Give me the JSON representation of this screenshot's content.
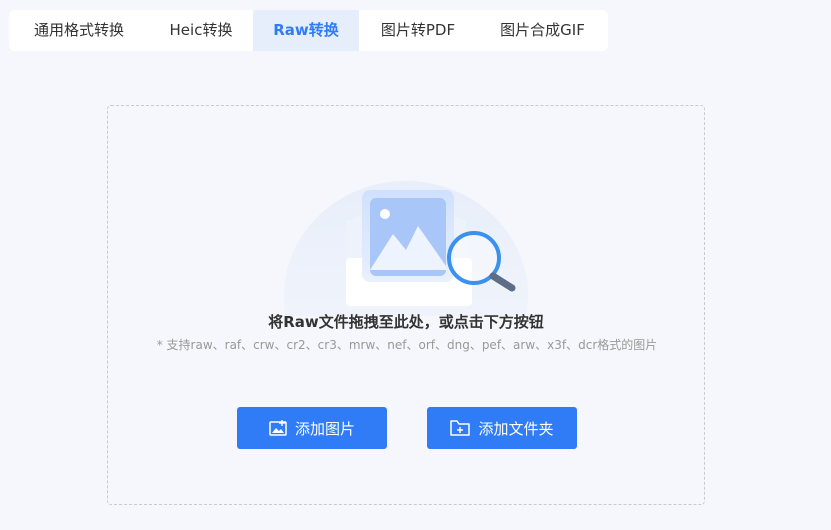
{
  "tabs": [
    {
      "label": "通用格式转换",
      "active": false
    },
    {
      "label": "Heic转换",
      "active": false
    },
    {
      "label": "Raw转换",
      "active": true
    },
    {
      "label": "图片转PDF",
      "active": false
    },
    {
      "label": "图片合成GIF",
      "active": false
    }
  ],
  "dropzone": {
    "main_text": "将Raw文件拖拽至此处，或点击下方按钮",
    "sub_text": "* 支持raw、raf、crw、cr2、cr3、mrw、nef、orf、dng、pef、arw、x3f、dcr格式的图片"
  },
  "buttons": {
    "add_image": "添加图片",
    "add_folder": "添加文件夹"
  },
  "colors": {
    "accent": "#2f7cf6",
    "active_tab_bg": "#e6eefc",
    "page_bg": "#f5f7fc"
  }
}
